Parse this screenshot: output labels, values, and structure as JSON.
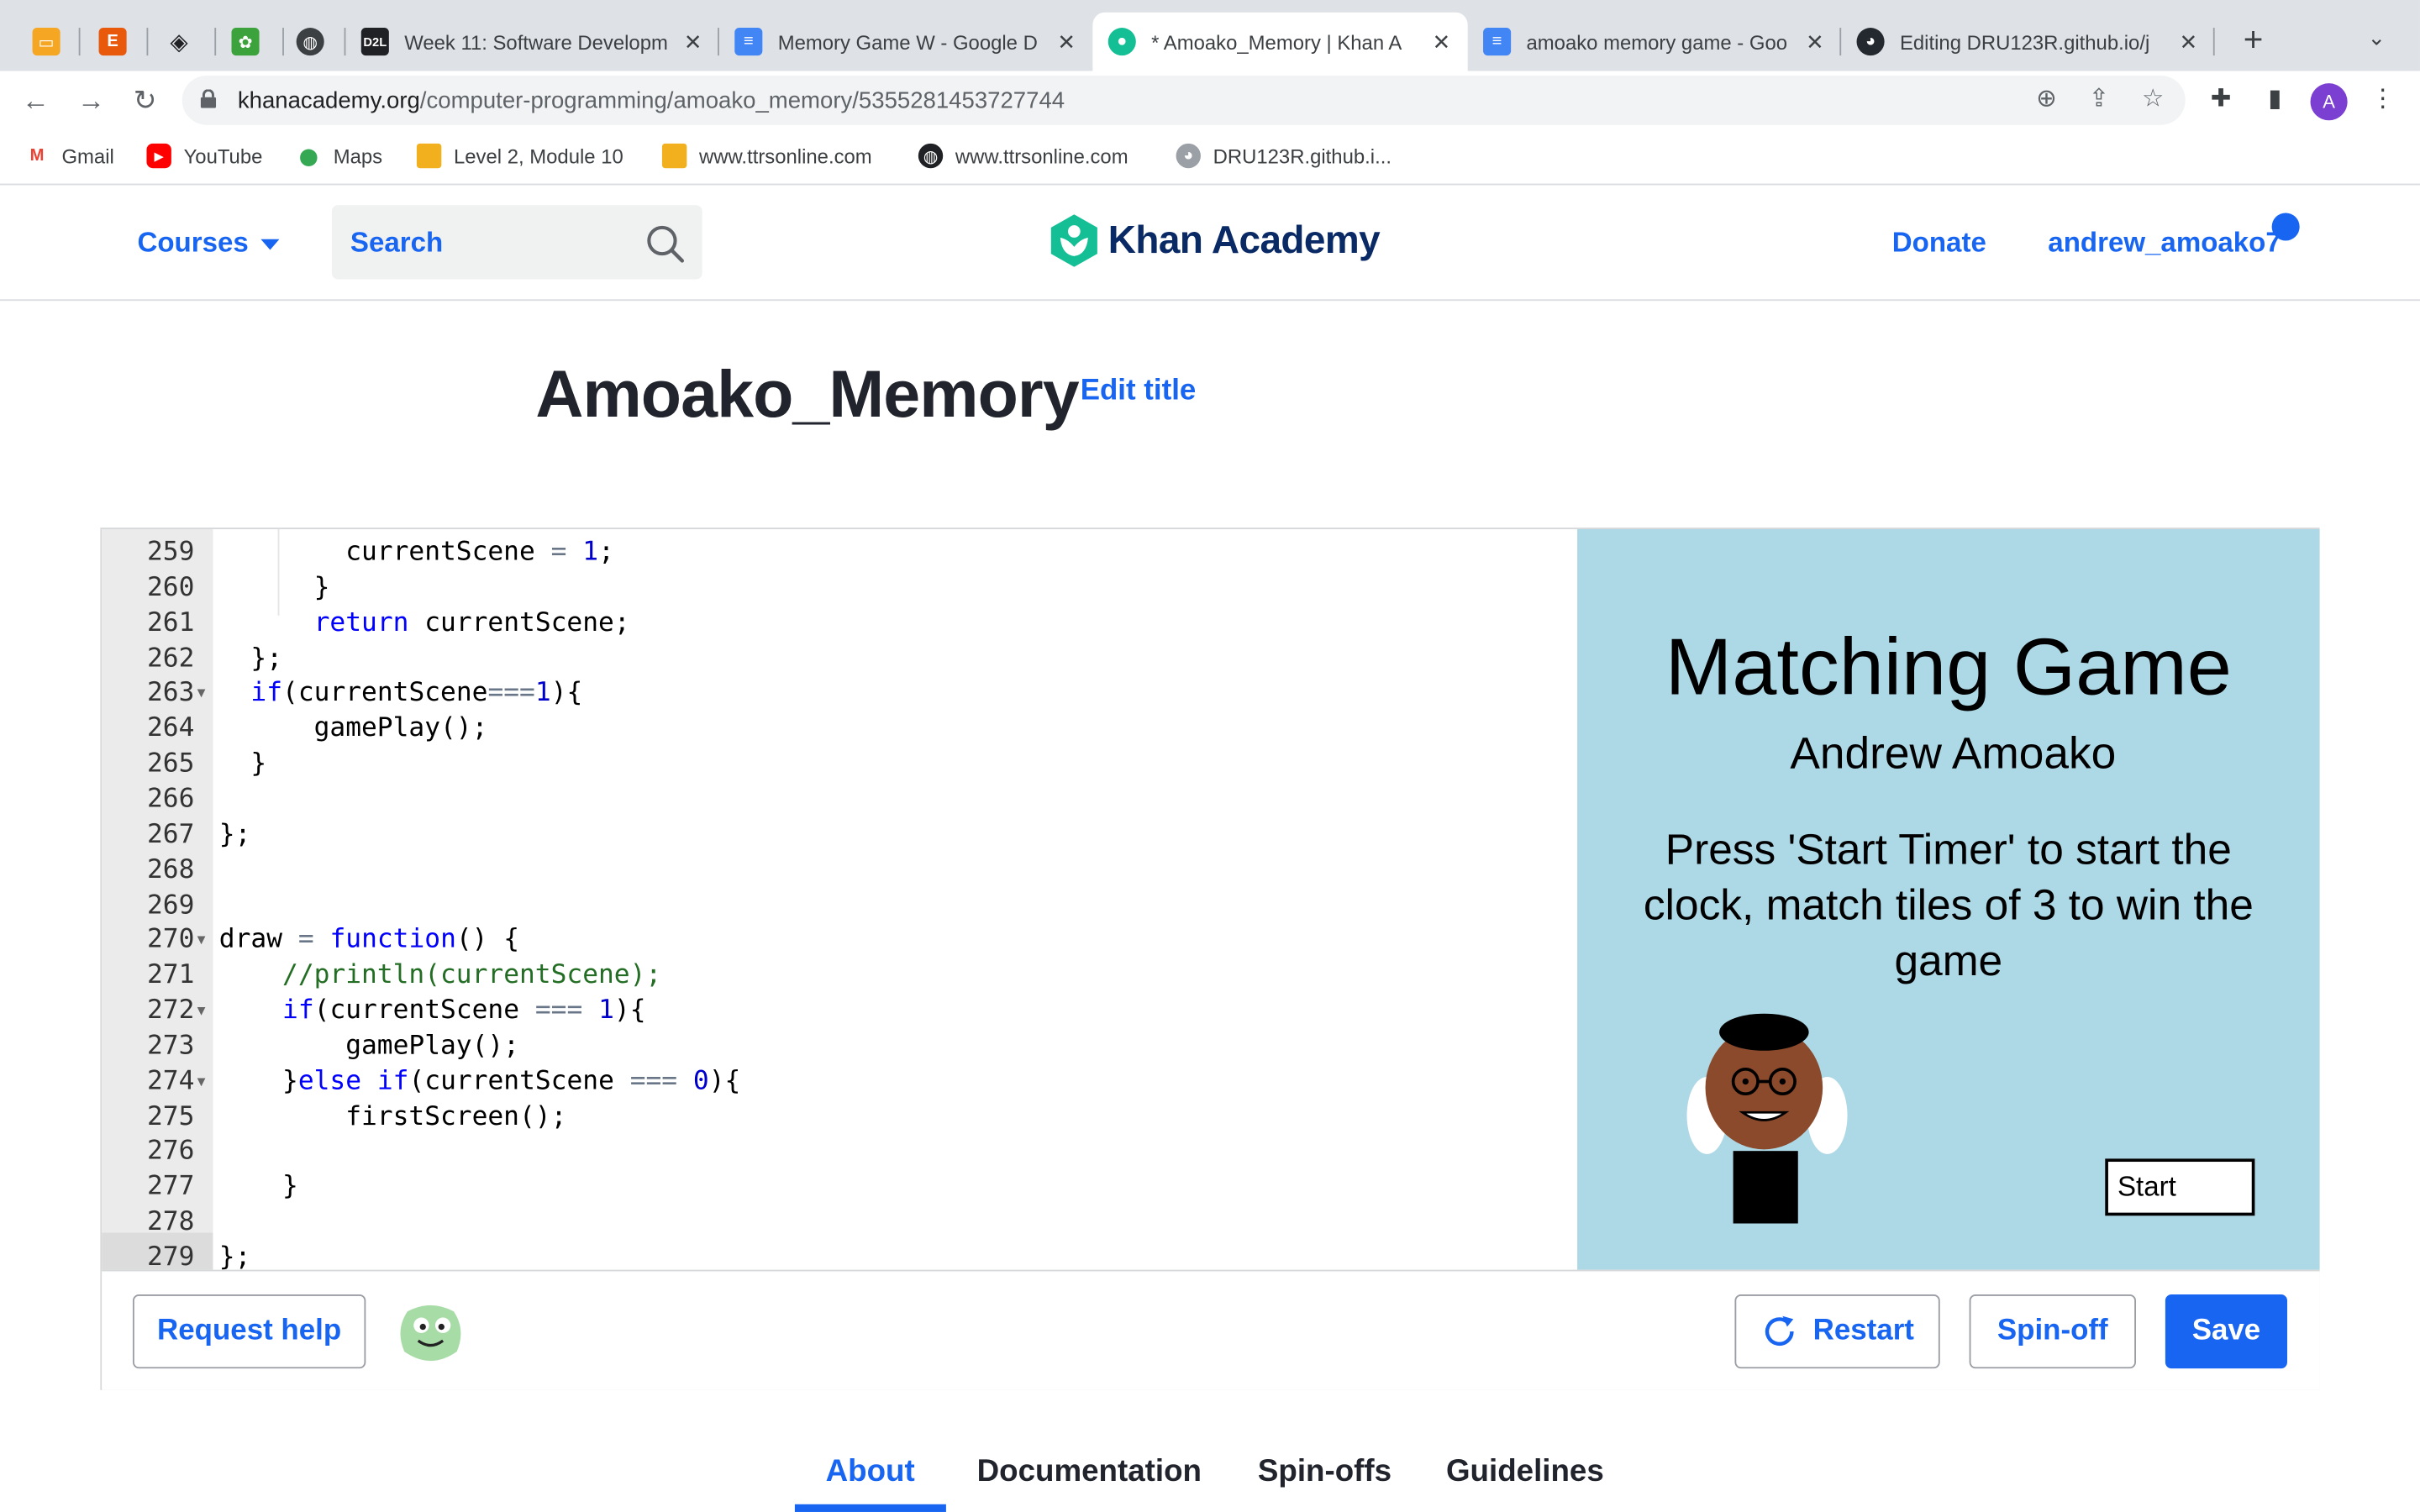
{
  "browser": {
    "tabs": [
      {
        "title": "",
        "favicon": "presentation-icon",
        "color": "#f5a623"
      },
      {
        "title": "",
        "favicon": "etsy-icon",
        "color": "#e8590c"
      },
      {
        "title": "",
        "favicon": "diamond-icon",
        "color": "#202124"
      },
      {
        "title": "",
        "favicon": "app-icon",
        "color": "#3ca23c"
      },
      {
        "title": "",
        "favicon": "globe-icon",
        "color": "#3c4043"
      },
      {
        "title": "Week 11: Software Developm",
        "favicon": "d2l-icon"
      },
      {
        "title": "Memory Game W - Google D",
        "favicon": "docs-icon"
      },
      {
        "title": "* Amoako_Memory | Khan A",
        "favicon": "khan-icon",
        "active": true
      },
      {
        "title": "amoako memory game - Goo",
        "favicon": "docs-icon"
      },
      {
        "title": "Editing DRU123R.github.io/j",
        "favicon": "github-icon"
      }
    ],
    "url_host": "khanacademy.org",
    "url_path": "/computer-programming/amoako_memory/5355281453727744",
    "profile_initial": "A",
    "bookmarks": [
      {
        "label": "Gmail",
        "icon": "gmail-icon"
      },
      {
        "label": "YouTube",
        "icon": "youtube-icon"
      },
      {
        "label": "Maps",
        "icon": "maps-icon"
      },
      {
        "label": "Level 2, Module 10",
        "icon": "folder-icon"
      },
      {
        "label": "www.ttrsonline.com",
        "icon": "folder-icon"
      },
      {
        "label": "www.ttrsonline.com",
        "icon": "globe-icon"
      },
      {
        "label": "DRU123R.github.i...",
        "icon": "github-icon"
      }
    ]
  },
  "header": {
    "courses": "Courses",
    "search_placeholder": "Search",
    "logo_text": "Khan Academy",
    "donate": "Donate",
    "username": "andrew_amoako7"
  },
  "program": {
    "title": "Amoako_Memory",
    "edit_title": "Edit title"
  },
  "editor": {
    "lines": [
      {
        "n": "259",
        "fold": false
      },
      {
        "n": "260",
        "fold": false
      },
      {
        "n": "261",
        "fold": false
      },
      {
        "n": "262",
        "fold": false
      },
      {
        "n": "263",
        "fold": true
      },
      {
        "n": "264",
        "fold": false
      },
      {
        "n": "265",
        "fold": false
      },
      {
        "n": "266",
        "fold": false
      },
      {
        "n": "267",
        "fold": false
      },
      {
        "n": "268",
        "fold": false
      },
      {
        "n": "269",
        "fold": false
      },
      {
        "n": "270",
        "fold": true
      },
      {
        "n": "271",
        "fold": false
      },
      {
        "n": "272",
        "fold": true
      },
      {
        "n": "273",
        "fold": false
      },
      {
        "n": "274",
        "fold": true
      },
      {
        "n": "275",
        "fold": false
      },
      {
        "n": "276",
        "fold": false
      },
      {
        "n": "277",
        "fold": false
      },
      {
        "n": "278",
        "fold": false
      },
      {
        "n": "279",
        "fold": false
      }
    ],
    "code": [
      "        currentScene = 1;",
      "      }",
      "      return currentScene;",
      "  };",
      "  if(currentScene===1){",
      "      gamePlay();",
      "  }",
      "",
      "};",
      "",
      "",
      "draw = function() {",
      "    //println(currentScene);",
      "    if(currentScene === 1){",
      "        gamePlay();",
      "    }else if(currentScene === 0){",
      "        firstScreen();",
      "",
      "    }",
      "",
      "};"
    ]
  },
  "canvas": {
    "title": "Matching Game",
    "author": "Andrew Amoako",
    "instructions": "Press 'Start Timer' to start the clock, match tiles of 3 to win the game",
    "start_button": "Start"
  },
  "actions": {
    "request_help": "Request help",
    "restart": "Restart",
    "spinoff": "Spin-off",
    "save": "Save"
  },
  "page_tabs": [
    "About",
    "Documentation",
    "Spin-offs",
    "Guidelines"
  ],
  "colors": {
    "ka_blue": "#1865f2",
    "canvas_bg": "#add8e6",
    "logo_green": "#14bf96"
  }
}
